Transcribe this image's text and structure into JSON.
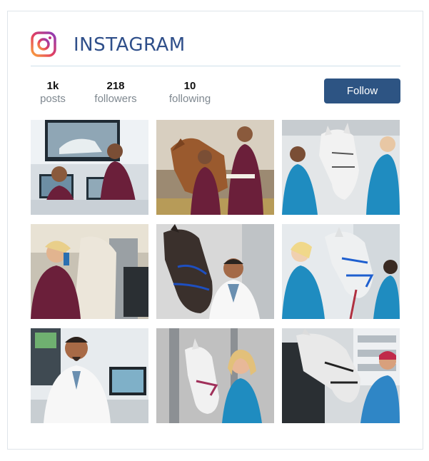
{
  "brand": {
    "name": "INSTAGRAM",
    "icon": "instagram-icon"
  },
  "stats": {
    "posts": {
      "value": "1k",
      "label": "posts"
    },
    "followers": {
      "value": "218",
      "label": "followers"
    },
    "following": {
      "value": "10",
      "label": "following"
    }
  },
  "follow_button": {
    "label": "Follow"
  },
  "colors": {
    "brand_text": "#2f4f8a",
    "button_bg": "#2d5483",
    "divider": "#cfe0ea"
  },
  "photos": [
    {
      "subject": "two vets at computer monitors with horse footage"
    },
    {
      "subject": "two vets with a chestnut horse in stable"
    },
    {
      "subject": "vets examining a white horse"
    },
    {
      "subject": "vet with stethoscope on horse"
    },
    {
      "subject": "vet smiling beside a dark horse"
    },
    {
      "subject": "vets treating a grey horse with blue halter"
    },
    {
      "subject": "lab technician at computer"
    },
    {
      "subject": "vet smiling with white horse"
    },
    {
      "subject": "man patting grey horse"
    }
  ]
}
